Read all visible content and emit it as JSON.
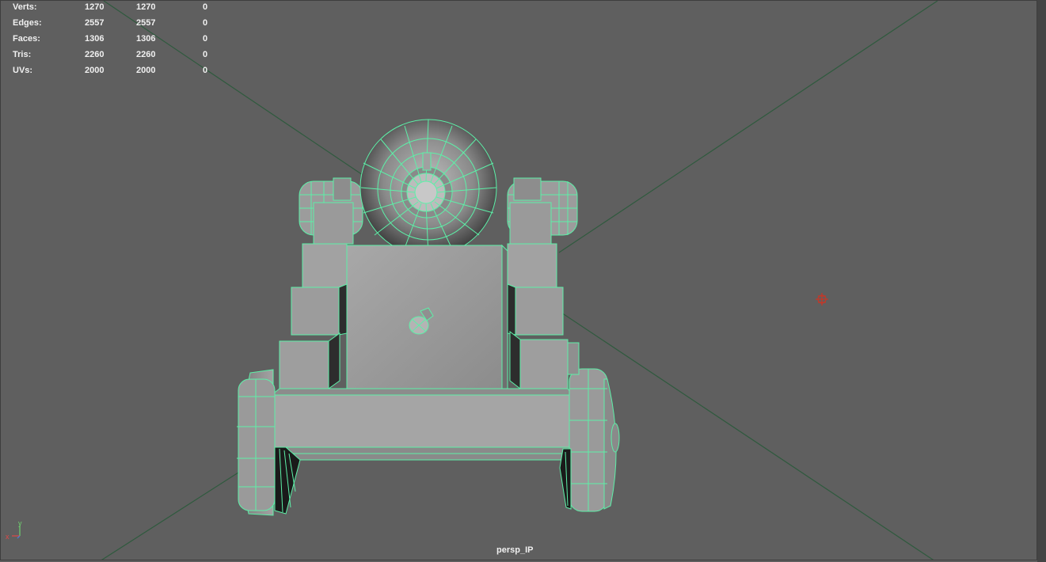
{
  "hud": {
    "rows": [
      {
        "label": "Verts:",
        "v1": "1270",
        "v2": "1270",
        "v3": "0"
      },
      {
        "label": "Edges:",
        "v1": "2557",
        "v2": "2557",
        "v3": "0"
      },
      {
        "label": "Faces:",
        "v1": "1306",
        "v2": "1306",
        "v3": "0"
      },
      {
        "label": "Tris:",
        "v1": "2260",
        "v2": "2260",
        "v3": "0"
      },
      {
        "label": "UVs:",
        "v1": "2000",
        "v2": "2000",
        "v3": "0"
      }
    ]
  },
  "viewport": {
    "camera_name": "persp_IP",
    "axis_x": "x",
    "axis_y": "y"
  },
  "colors": {
    "background": "#5f5f5f",
    "wireframe": "#5df0a8",
    "grid_line": "#2f5a3e",
    "geometry_fill": "#9a9a9a"
  },
  "icons": {
    "pivot": "pivot-crosshair-icon",
    "axis": "axis-gizmo-icon"
  }
}
